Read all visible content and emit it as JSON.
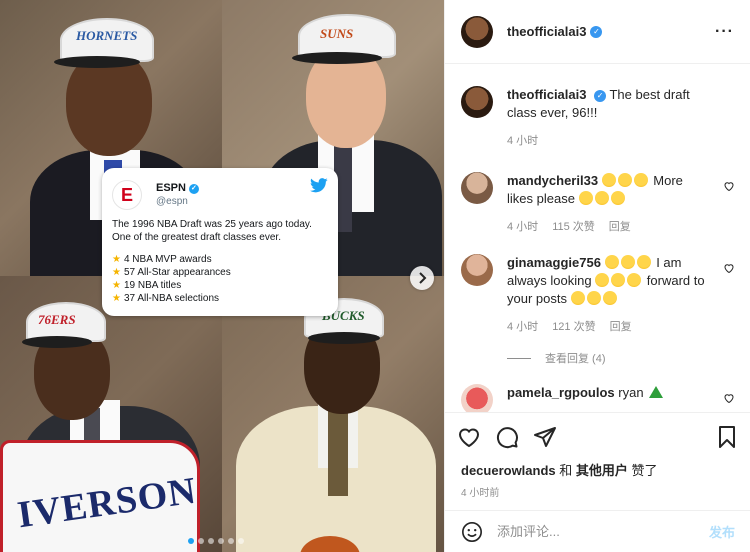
{
  "image": {
    "tweet": {
      "logo": "E",
      "name": "ESPN",
      "handle": "@espn",
      "text": "The 1996 NBA Draft was 25 years ago today. One of the greatest draft classes ever.",
      "stats": [
        "4 NBA MVP awards",
        "57 All-Star appearances",
        "19 NBA titles",
        "37 All-NBA selections"
      ]
    },
    "cap_labels": [
      "HORNETS",
      "SUNS",
      "76ERS",
      "BUCKS"
    ],
    "jersey_text": "IVERSON"
  },
  "header": {
    "username": "theofficialai3",
    "more_icon": "more-icon"
  },
  "caption": {
    "username": "theofficialai3",
    "text": "The best draft class ever, 96!!!",
    "time": "4 小时"
  },
  "comments": [
    {
      "username": "mandycheril33",
      "text_before": "",
      "text_mid": "More likes please",
      "time": "4 小时",
      "likes": "115 次赞",
      "reply": "回复"
    },
    {
      "username": "ginamaggie756",
      "text_a": "I am always looking",
      "text_b": "forward to your posts",
      "time": "4 小时",
      "likes": "121 次赞",
      "reply": "回复",
      "view_replies": "查看回复 (4)"
    },
    {
      "username": "pamela_rgpoulos",
      "text": "ryan"
    }
  ],
  "liked_by": {
    "user": "decuerowlands",
    "middle": " 和 ",
    "others": "其他用户",
    "suffix": " 赞了"
  },
  "post_time": "4 小时前",
  "add_comment": {
    "placeholder": "添加评论...",
    "post_label": "发布"
  },
  "colors": {
    "verified": "#3897f0",
    "post_button": "#b2dffc",
    "espn_red": "#d0011b",
    "twitter_blue": "#1da1f2"
  }
}
